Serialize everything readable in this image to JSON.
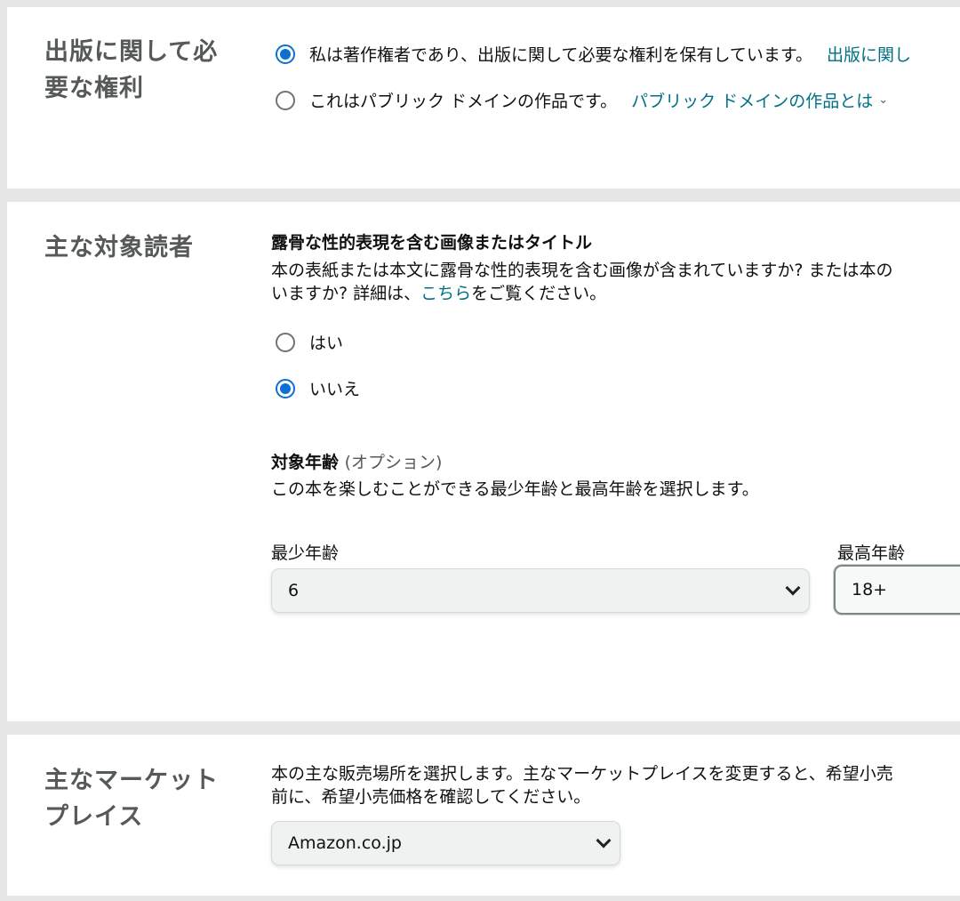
{
  "rights": {
    "title_line1": "出版に関して必",
    "title_line2": "要な権利",
    "option_owner": "私は著作権者であり、出版に関して必要な権利を保有しています。",
    "option_owner_link": "出版に関し",
    "option_public": "これはパブリック ドメインの作品です。",
    "option_public_link": "パブリック ドメインの作品とは"
  },
  "audience": {
    "title": "主な対象読者",
    "explicit_heading": "露骨な性的表現を含む画像またはタイトル",
    "explicit_desc_line1": "本の表紙または本文に露骨な性的表現を含む画像が含まれていますか? または本の",
    "explicit_desc_line2_pre": "いますか? 詳細は、",
    "explicit_desc_link": "こちら",
    "explicit_desc_line2_post": "をご覧ください。",
    "option_yes": "はい",
    "option_no": "いいえ",
    "age_heading": "対象年齢",
    "age_optional": "(オプション)",
    "age_desc": "この本を楽しむことができる最少年齢と最高年齢を選択します。",
    "min_age_label": "最少年齢",
    "min_age_value": "6",
    "max_age_label": "最高年齢",
    "max_age_value": "18+"
  },
  "market": {
    "title_line1": "主なマーケット",
    "title_line2": "プレイス",
    "desc_line1": "本の主な販売場所を選択します。主なマーケットプレイスを変更すると、希望小売",
    "desc_line2": "前に、希望小売価格を確認してください。",
    "value": "Amazon.co.jp"
  },
  "colors": {
    "link": "#007185",
    "radio_selected": "#0b6fd4",
    "page_background": "#e6e6e6",
    "section_title": "#565959"
  }
}
